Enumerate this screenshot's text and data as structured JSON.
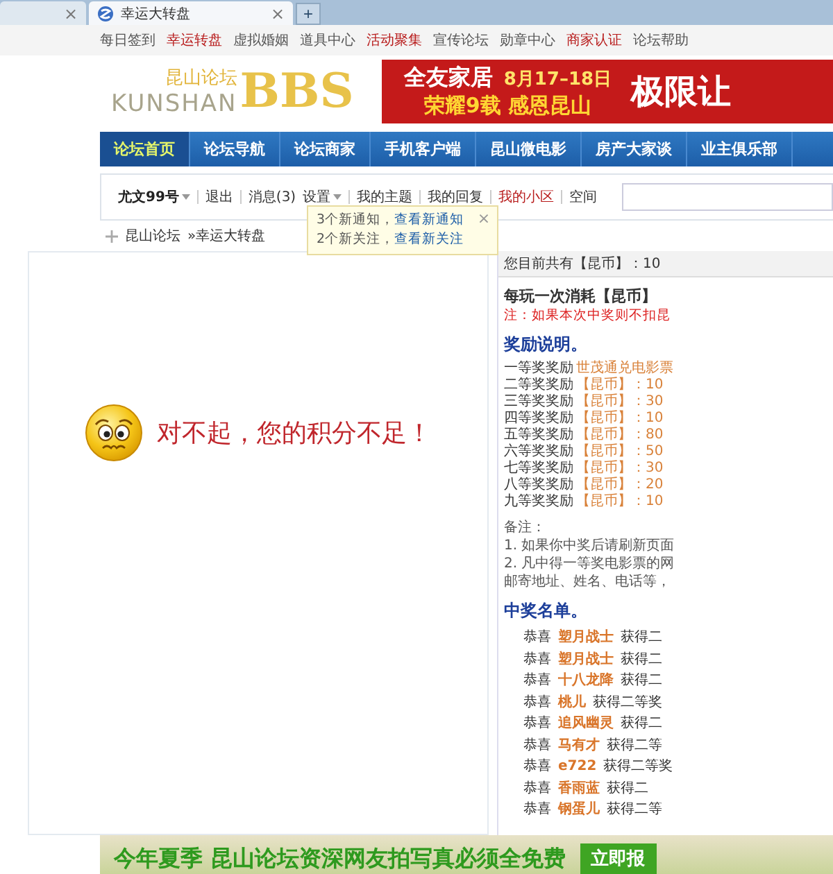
{
  "browser_tabs": [
    {
      "selected": false,
      "close": "×"
    },
    {
      "label": "幸运大转盘",
      "selected": true,
      "close": "×"
    }
  ],
  "new_tab": "+",
  "top_links": [
    {
      "label": "每日签到",
      "highlighted": false
    },
    {
      "label": "幸运转盘",
      "highlighted": true
    },
    {
      "label": "虚拟婚姻",
      "highlighted": false
    },
    {
      "label": "道具中心",
      "highlighted": false
    },
    {
      "label": "活动聚集",
      "highlighted": true
    },
    {
      "label": "宣传论坛",
      "highlighted": false
    },
    {
      "label": "勋章中心",
      "highlighted": false
    },
    {
      "label": "商家认证",
      "highlighted": true
    },
    {
      "label": "论坛帮助",
      "highlighted": false
    }
  ],
  "logo": {
    "chinese": "昆山论坛",
    "latin": "KUNSHAN",
    "mark": "BBS"
  },
  "banner": {
    "brand": "全友家居",
    "date": "8月17–18日",
    "slogan": "荣耀9载 感恩昆山",
    "promo": "极限让"
  },
  "nav": [
    {
      "label": "论坛首页",
      "selected": true
    },
    {
      "label": "论坛导航",
      "selected": false
    },
    {
      "label": "论坛商家",
      "selected": false
    },
    {
      "label": "手机客户端",
      "selected": false
    },
    {
      "label": "昆山微电影",
      "selected": false
    },
    {
      "label": "房产大家谈",
      "selected": false
    },
    {
      "label": "业主俱乐部",
      "selected": false
    }
  ],
  "user_bar": [
    {
      "label": "尤文99号",
      "kind": "user"
    },
    {
      "label": "退出",
      "kind": "link"
    },
    {
      "label": "消息(3)",
      "kind": "link"
    },
    {
      "label": "设置",
      "kind": "menu"
    },
    {
      "label": "我的主题",
      "kind": "link"
    },
    {
      "label": "我的回复",
      "kind": "link"
    },
    {
      "label": "我的小区",
      "kind": "hot"
    },
    {
      "label": "空间",
      "kind": "link"
    }
  ],
  "notice_popup": [
    {
      "text": "3个新通知，",
      "link": "查看新通知"
    },
    {
      "text": "2个新关注，",
      "link": "查看新关注"
    }
  ],
  "notice_close": "×",
  "breadcrumb": [
    "昆山论坛",
    "»幸运大转盘"
  ],
  "message": "对不起，您的积分不足！",
  "sidebar": {
    "balance": "您目前共有【昆币】：10",
    "cost": "每玩一次消耗【昆币】",
    "note": "注：如果本次中奖则不扣昆",
    "rewards_title": "奖励说明。",
    "rewards": [
      {
        "prize": "一等奖奖励",
        "reward": "世茂通兑电影票"
      },
      {
        "prize": "二等奖奖励",
        "reward": "【昆币】：10"
      },
      {
        "prize": "三等奖奖励",
        "reward": "【昆币】：30"
      },
      {
        "prize": "四等奖奖励",
        "reward": "【昆币】：10"
      },
      {
        "prize": "五等奖奖励",
        "reward": "【昆币】：80"
      },
      {
        "prize": "六等奖奖励",
        "reward": "【昆币】：50"
      },
      {
        "prize": "七等奖奖励",
        "reward": "【昆币】：30"
      },
      {
        "prize": "八等奖奖励",
        "reward": "【昆币】：20"
      },
      {
        "prize": "九等奖奖励",
        "reward": "【昆币】：10"
      }
    ],
    "remarks_title": "备注：",
    "remarks": [
      "1. 如果你中奖后请刷新页面",
      "2. 凡中得一等奖电影票的网",
      "邮寄地址、姓名、电话等，"
    ],
    "winners_title": "中奖名单。",
    "winners": [
      {
        "prefix": "恭喜",
        "name": "塑月战士",
        "prize": "获得二"
      },
      {
        "prefix": "恭喜",
        "name": "塑月战士",
        "prize": "获得二"
      },
      {
        "prefix": "恭喜",
        "name": "十八龙降",
        "prize": "获得二"
      },
      {
        "prefix": "恭喜",
        "name": "桃儿",
        "prize": "获得二等奖"
      },
      {
        "prefix": "恭喜",
        "name": "追风幽灵",
        "prize": "获得二"
      },
      {
        "prefix": "恭喜",
        "name": "马有才",
        "prize": "获得二等"
      },
      {
        "prefix": "恭喜",
        "name": "e722",
        "prize": "获得二等奖"
      },
      {
        "prefix": "恭喜",
        "name": "香雨蓝",
        "prize": "获得二"
      },
      {
        "prefix": "恭喜",
        "name": "钢蛋儿",
        "prize": "获得二等"
      }
    ]
  },
  "bottom_ad": {
    "text": "今年夏季 昆山论坛资深网友拍写真必须全免费",
    "button": "立即报"
  }
}
